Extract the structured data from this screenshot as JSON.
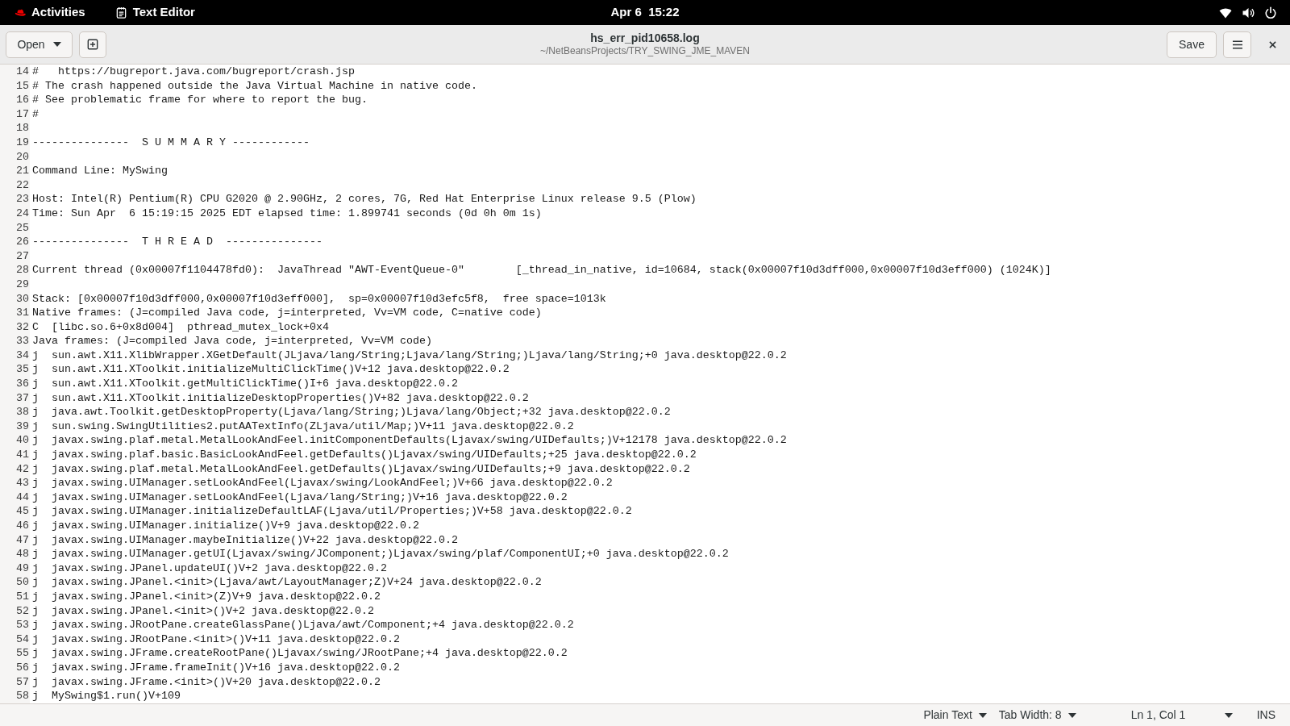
{
  "top_bar": {
    "activities": "Activities",
    "app_name": "Text Editor",
    "clock": "Apr 6  15:22"
  },
  "header_bar": {
    "open_button": "Open",
    "title": "hs_err_pid10658.log",
    "subtitle": "~/NetBeansProjects/TRY_SWING_JME_MAVEN",
    "save_button": "Save"
  },
  "editor": {
    "lines": [
      {
        "number": "14",
        "text": "#   https://bugreport.java.com/bugreport/crash.jsp"
      },
      {
        "number": "15",
        "text": "# The crash happened outside the Java Virtual Machine in native code."
      },
      {
        "number": "16",
        "text": "# See problematic frame for where to report the bug."
      },
      {
        "number": "17",
        "text": "#"
      },
      {
        "number": "18"
      },
      {
        "number": "19",
        "text": "---------------  S U M M A R Y ------------"
      },
      {
        "number": "20"
      },
      {
        "number": "21",
        "text": "Command Line: MySwing"
      },
      {
        "number": "22"
      },
      {
        "number": "23",
        "text": "Host: Intel(R) Pentium(R) CPU G2020 @ 2.90GHz, 2 cores, 7G, Red Hat Enterprise Linux release 9.5 (Plow)"
      },
      {
        "number": "24",
        "text": "Time: Sun Apr  6 15:19:15 2025 EDT elapsed time: 1.899741 seconds (0d 0h 0m 1s)"
      },
      {
        "number": "25"
      },
      {
        "number": "26",
        "text": "---------------  T H R E A D  ---------------"
      },
      {
        "number": "27"
      },
      {
        "number": "28",
        "text": "Current thread (0x00007f1104478fd0):  JavaThread \"AWT-EventQueue-0\"        [_thread_in_native, id=10684, stack(0x00007f10d3dff000,0x00007f10d3eff000) (1024K)]"
      },
      {
        "number": "29"
      },
      {
        "number": "30",
        "text": "Stack: [0x00007f10d3dff000,0x00007f10d3eff000],  sp=0x00007f10d3efc5f8,  free space=1013k"
      },
      {
        "number": "31",
        "text": "Native frames: (J=compiled Java code, j=interpreted, Vv=VM code, C=native code)"
      },
      {
        "number": "32",
        "text": "C  [libc.so.6+0x8d004]  pthread_mutex_lock+0x4"
      },
      {
        "number": "33",
        "text": "Java frames: (J=compiled Java code, j=interpreted, Vv=VM code)"
      },
      {
        "number": "34",
        "text": "j  sun.awt.X11.XlibWrapper.XGetDefault(JLjava/lang/String;Ljava/lang/String;)Ljava/lang/String;+0 java.desktop@22.0.2"
      },
      {
        "number": "35",
        "text": "j  sun.awt.X11.XToolkit.initializeMultiClickTime()V+12 java.desktop@22.0.2"
      },
      {
        "number": "36",
        "text": "j  sun.awt.X11.XToolkit.getMultiClickTime()I+6 java.desktop@22.0.2"
      },
      {
        "number": "37",
        "text": "j  sun.awt.X11.XToolkit.initializeDesktopProperties()V+82 java.desktop@22.0.2"
      },
      {
        "number": "38",
        "text": "j  java.awt.Toolkit.getDesktopProperty(Ljava/lang/String;)Ljava/lang/Object;+32 java.desktop@22.0.2"
      },
      {
        "number": "39",
        "text": "j  sun.swing.SwingUtilities2.putAATextInfo(ZLjava/util/Map;)V+11 java.desktop@22.0.2"
      },
      {
        "number": "40",
        "text": "j  javax.swing.plaf.metal.MetalLookAndFeel.initComponentDefaults(Ljavax/swing/UIDefaults;)V+12178 java.desktop@22.0.2"
      },
      {
        "number": "41",
        "text": "j  javax.swing.plaf.basic.BasicLookAndFeel.getDefaults()Ljavax/swing/UIDefaults;+25 java.desktop@22.0.2"
      },
      {
        "number": "42",
        "text": "j  javax.swing.plaf.metal.MetalLookAndFeel.getDefaults()Ljavax/swing/UIDefaults;+9 java.desktop@22.0.2"
      },
      {
        "number": "43",
        "text": "j  javax.swing.UIManager.setLookAndFeel(Ljavax/swing/LookAndFeel;)V+66 java.desktop@22.0.2"
      },
      {
        "number": "44",
        "text": "j  javax.swing.UIManager.setLookAndFeel(Ljava/lang/String;)V+16 java.desktop@22.0.2"
      },
      {
        "number": "45",
        "text": "j  javax.swing.UIManager.initializeDefaultLAF(Ljava/util/Properties;)V+58 java.desktop@22.0.2"
      },
      {
        "number": "46",
        "text": "j  javax.swing.UIManager.initialize()V+9 java.desktop@22.0.2"
      },
      {
        "number": "47",
        "text": "j  javax.swing.UIManager.maybeInitialize()V+22 java.desktop@22.0.2"
      },
      {
        "number": "48",
        "text": "j  javax.swing.UIManager.getUI(Ljavax/swing/JComponent;)Ljavax/swing/plaf/ComponentUI;+0 java.desktop@22.0.2"
      },
      {
        "number": "49",
        "text": "j  javax.swing.JPanel.updateUI()V+2 java.desktop@22.0.2"
      },
      {
        "number": "50",
        "text": "j  javax.swing.JPanel.<init>(Ljava/awt/LayoutManager;Z)V+24 java.desktop@22.0.2"
      },
      {
        "number": "51",
        "text": "j  javax.swing.JPanel.<init>(Z)V+9 java.desktop@22.0.2"
      },
      {
        "number": "52",
        "text": "j  javax.swing.JPanel.<init>()V+2 java.desktop@22.0.2"
      },
      {
        "number": "53",
        "text": "j  javax.swing.JRootPane.createGlassPane()Ljava/awt/Component;+4 java.desktop@22.0.2"
      },
      {
        "number": "54",
        "text": "j  javax.swing.JRootPane.<init>()V+11 java.desktop@22.0.2"
      },
      {
        "number": "55",
        "text": "j  javax.swing.JFrame.createRootPane()Ljavax/swing/JRootPane;+4 java.desktop@22.0.2"
      },
      {
        "number": "56",
        "text": "j  javax.swing.JFrame.frameInit()V+16 java.desktop@22.0.2"
      },
      {
        "number": "57",
        "text": "j  javax.swing.JFrame.<init>()V+20 java.desktop@22.0.2"
      },
      {
        "number": "58",
        "text": "j  MySwing$1.run()V+109"
      }
    ]
  },
  "status_bar": {
    "language": "Plain Text",
    "tab_width": "Tab Width: 8",
    "cursor_position": "Ln 1, Col 1",
    "input_mode": "INS"
  }
}
